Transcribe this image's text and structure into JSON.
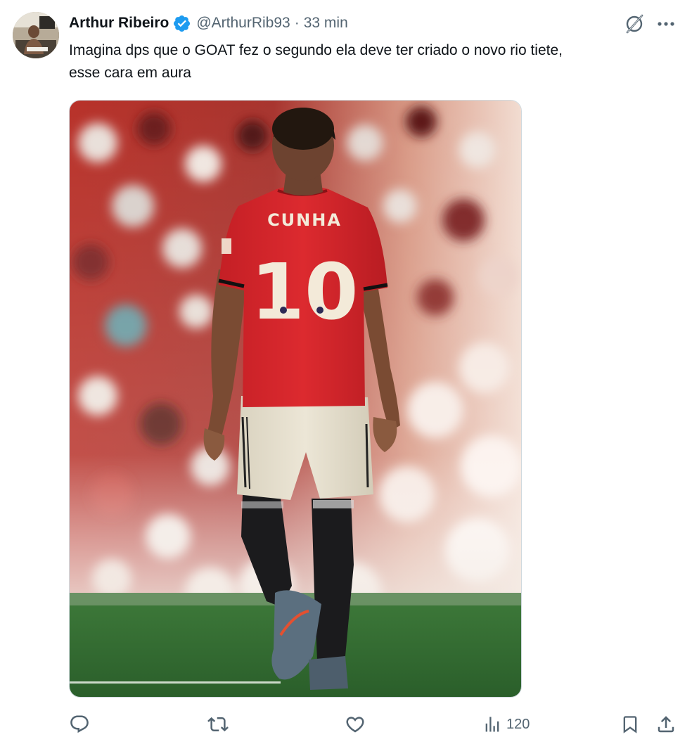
{
  "author": {
    "display_name": "Arthur Ribeiro",
    "handle": "@ArthurRib93",
    "separator": "·",
    "timestamp": "33 min",
    "verified": true
  },
  "tweet": {
    "text": "Imagina dps que o GOAT fez o segundo ela deve ter criado o novo rio tiete,\nesse cara em aura"
  },
  "media": {
    "jersey_name": "CUNHA",
    "jersey_number": "10"
  },
  "actions": {
    "reply_count": "",
    "retweet_count": "",
    "like_count": "",
    "views_count": "120"
  },
  "colors": {
    "verified": "#1d9bf0",
    "secondary_text": "#536471",
    "primary_text": "#0f1419",
    "jersey_red": "#d7262b"
  },
  "icons": {
    "reply": "reply-icon",
    "retweet": "retweet-icon",
    "like": "like-icon",
    "views": "views-icon",
    "bookmark": "bookmark-icon",
    "share": "share-icon",
    "grok": "grok-icon",
    "more": "more-icon"
  }
}
